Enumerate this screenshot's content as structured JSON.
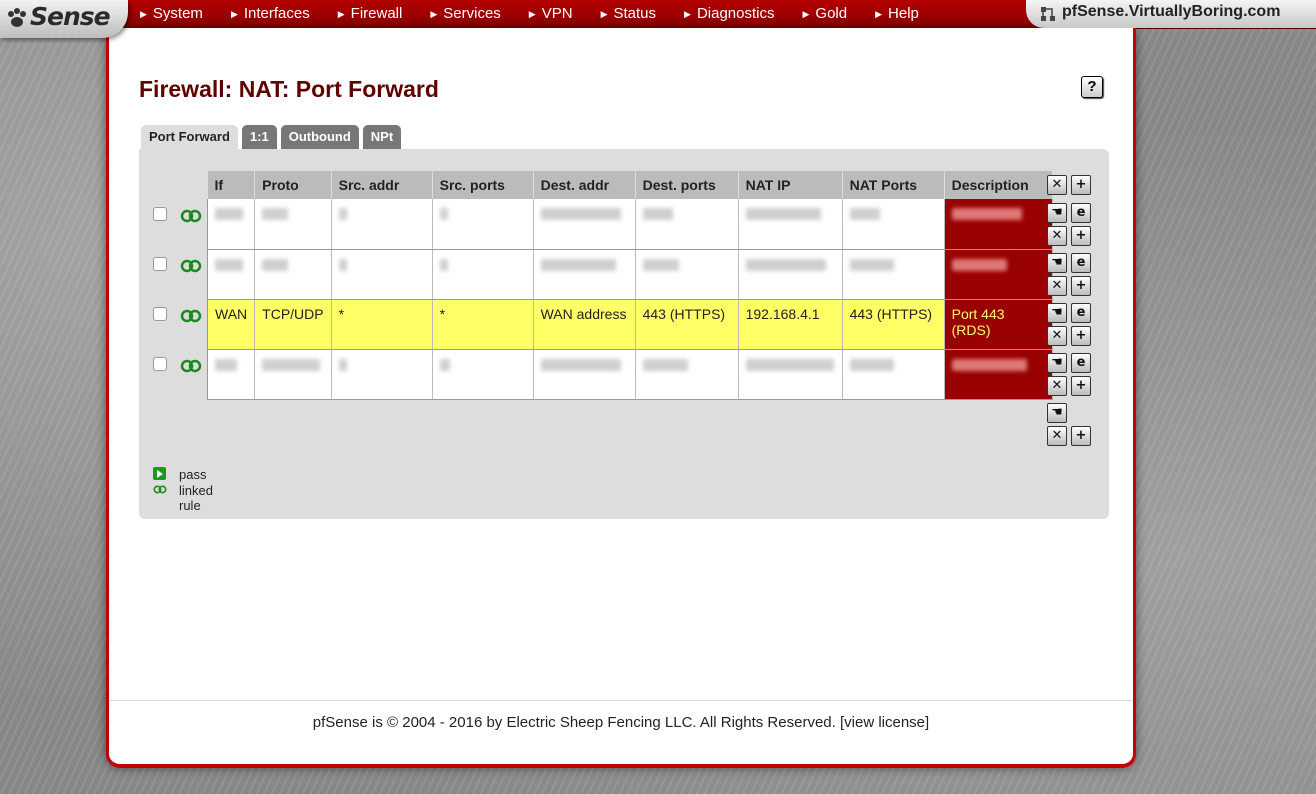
{
  "brand": {
    "logo_text": "Sense",
    "hostname": "pfSense.VirtuallyBoring.com"
  },
  "nav": {
    "items": [
      {
        "label": "System"
      },
      {
        "label": "Interfaces"
      },
      {
        "label": "Firewall"
      },
      {
        "label": "Services"
      },
      {
        "label": "VPN"
      },
      {
        "label": "Status"
      },
      {
        "label": "Diagnostics"
      },
      {
        "label": "Gold"
      },
      {
        "label": "Help"
      }
    ]
  },
  "page": {
    "title": "Firewall: NAT: Port Forward",
    "help_icon": "?"
  },
  "tabs": [
    {
      "label": "Port Forward",
      "active": true
    },
    {
      "label": "1:1",
      "active": false
    },
    {
      "label": "Outbound",
      "active": false
    },
    {
      "label": "NPt",
      "active": false
    }
  ],
  "table": {
    "headers": [
      "If",
      "Proto",
      "Src. addr",
      "Src. ports",
      "Dest. addr",
      "Dest. ports",
      "NAT IP",
      "NAT Ports",
      "Description"
    ],
    "visible_row": {
      "if": "WAN",
      "proto": "TCP/UDP",
      "src_addr": "*",
      "src_ports": "*",
      "dest_addr": "WAN address",
      "dest_ports": "443 (HTTPS)",
      "nat_ip": "192.168.4.1",
      "nat_ports": "443 (HTTPS)",
      "description": "Port 443 (RDS)"
    },
    "redacted_rows": 3
  },
  "legend": {
    "pass": "pass",
    "linked": "linked rule"
  },
  "footer": {
    "text": "pfSense is © 2004 - 2016 by Electric Sheep Fencing LLC. All Rights Reserved. [",
    "link": "view license",
    "close": "]"
  },
  "colors": {
    "accent": "#c40000",
    "description_bg": "#990000",
    "highlight": "#ffff66",
    "title": "#600000"
  },
  "icons": [
    "paw-logo-icon",
    "network-icon",
    "help-icon",
    "linked-rule-icon",
    "delete-icon",
    "add-icon",
    "edit-icon",
    "pass-icon",
    "move-icon"
  ]
}
